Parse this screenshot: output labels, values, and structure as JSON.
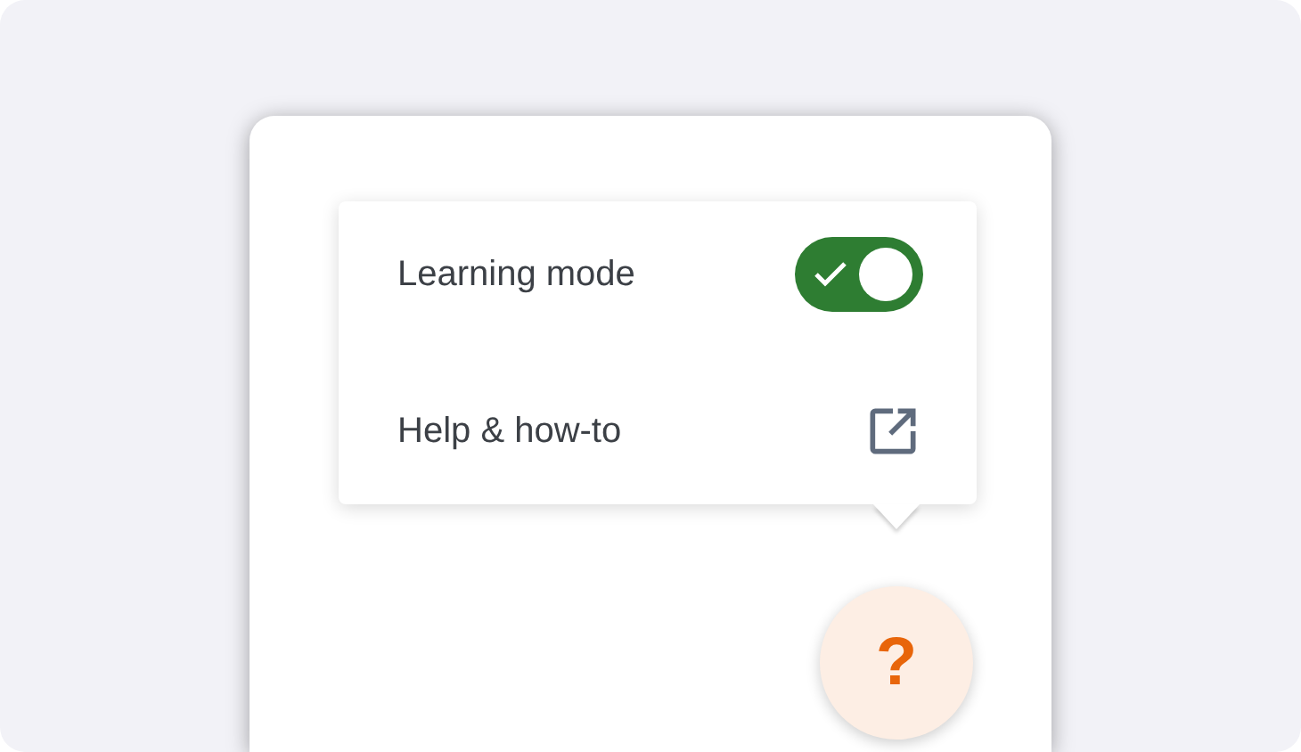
{
  "menu": {
    "items": [
      {
        "kind": "toggle",
        "label": "Learning mode",
        "on": true
      },
      {
        "kind": "link",
        "label": "Help & how-to"
      }
    ]
  },
  "help_button": {
    "label": "?"
  }
}
